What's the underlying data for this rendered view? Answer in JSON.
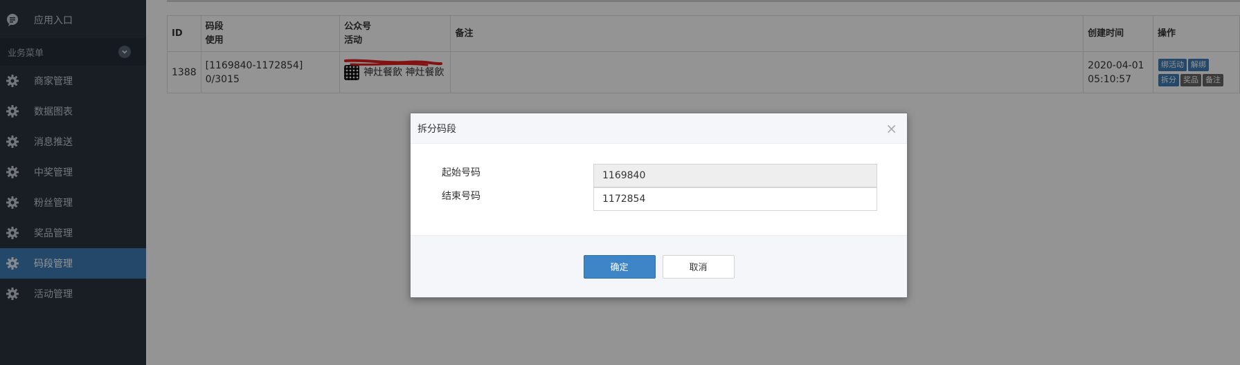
{
  "sidebar": {
    "top_item": {
      "label": "应用入口",
      "icon": "chat-icon"
    },
    "section": {
      "label": "业务菜单",
      "icon": "chevron-down-icon"
    },
    "items": [
      {
        "label": "商家管理",
        "icon": "gear-icon"
      },
      {
        "label": "数据图表",
        "icon": "gear-icon"
      },
      {
        "label": "消息推送",
        "icon": "gear-icon"
      },
      {
        "label": "中奖管理",
        "icon": "gear-icon"
      },
      {
        "label": "粉丝管理",
        "icon": "gear-icon"
      },
      {
        "label": "奖品管理",
        "icon": "gear-icon"
      },
      {
        "label": "码段管理",
        "icon": "gear-icon",
        "active": true
      },
      {
        "label": "活动管理",
        "icon": "gear-icon"
      }
    ]
  },
  "table": {
    "headers": {
      "id": "ID",
      "segment_line1": "码段",
      "segment_line2": "使用",
      "account_line1": "公众号",
      "account_line2": "活动",
      "remark": "备注",
      "created": "创建时间",
      "actions": "操作"
    },
    "rows": [
      {
        "id": "1388",
        "segment": "[1169840-1172854]",
        "usage": "0/3015",
        "account": "神灶餐飲 神灶餐飲",
        "remark": "",
        "created_date": "2020-04-01",
        "created_time": "05:10:57",
        "actions": [
          "绑活动",
          "解绑",
          "拆分",
          "奖品",
          "备注"
        ]
      }
    ]
  },
  "modal": {
    "title": "拆分码段",
    "close_symbol": "×",
    "start_label": "起始号码",
    "start_value": "1169840",
    "end_label": "结束号码",
    "end_value": "1172854",
    "confirm": "确定",
    "cancel": "取消"
  },
  "colors": {
    "sidebar_bg": "#2b3440",
    "accent": "#3d7cb6",
    "action_gray": "#666666"
  }
}
